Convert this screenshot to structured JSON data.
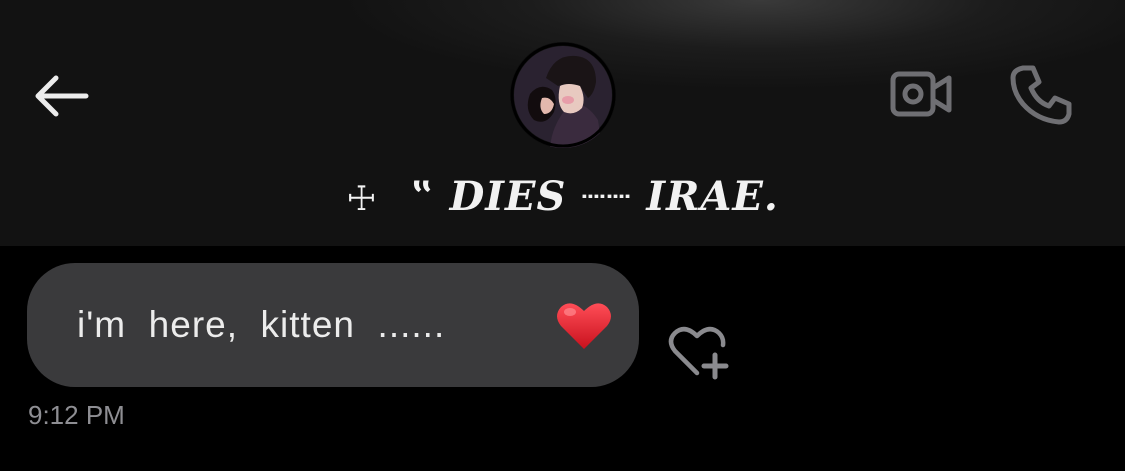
{
  "header": {
    "back_icon": "arrow-left-icon",
    "video_icon": "video-camera-icon",
    "call_icon": "phone-icon",
    "title": {
      "cross": "☩",
      "name": "‟ DIES ┈┈ IRAE."
    }
  },
  "message": {
    "text": "i'm  here,  kitten  ......",
    "emoji": "❤️",
    "timestamp": "9:12 PM",
    "react_icon": "heart-plus-icon"
  },
  "colors": {
    "background": "#000000",
    "header_background": "#121212",
    "bubble": "#3a3a3c",
    "text": "#ececec",
    "icon_gray": "#6f6f73",
    "timestamp": "#8e8e93",
    "heart": "#e0252f"
  }
}
